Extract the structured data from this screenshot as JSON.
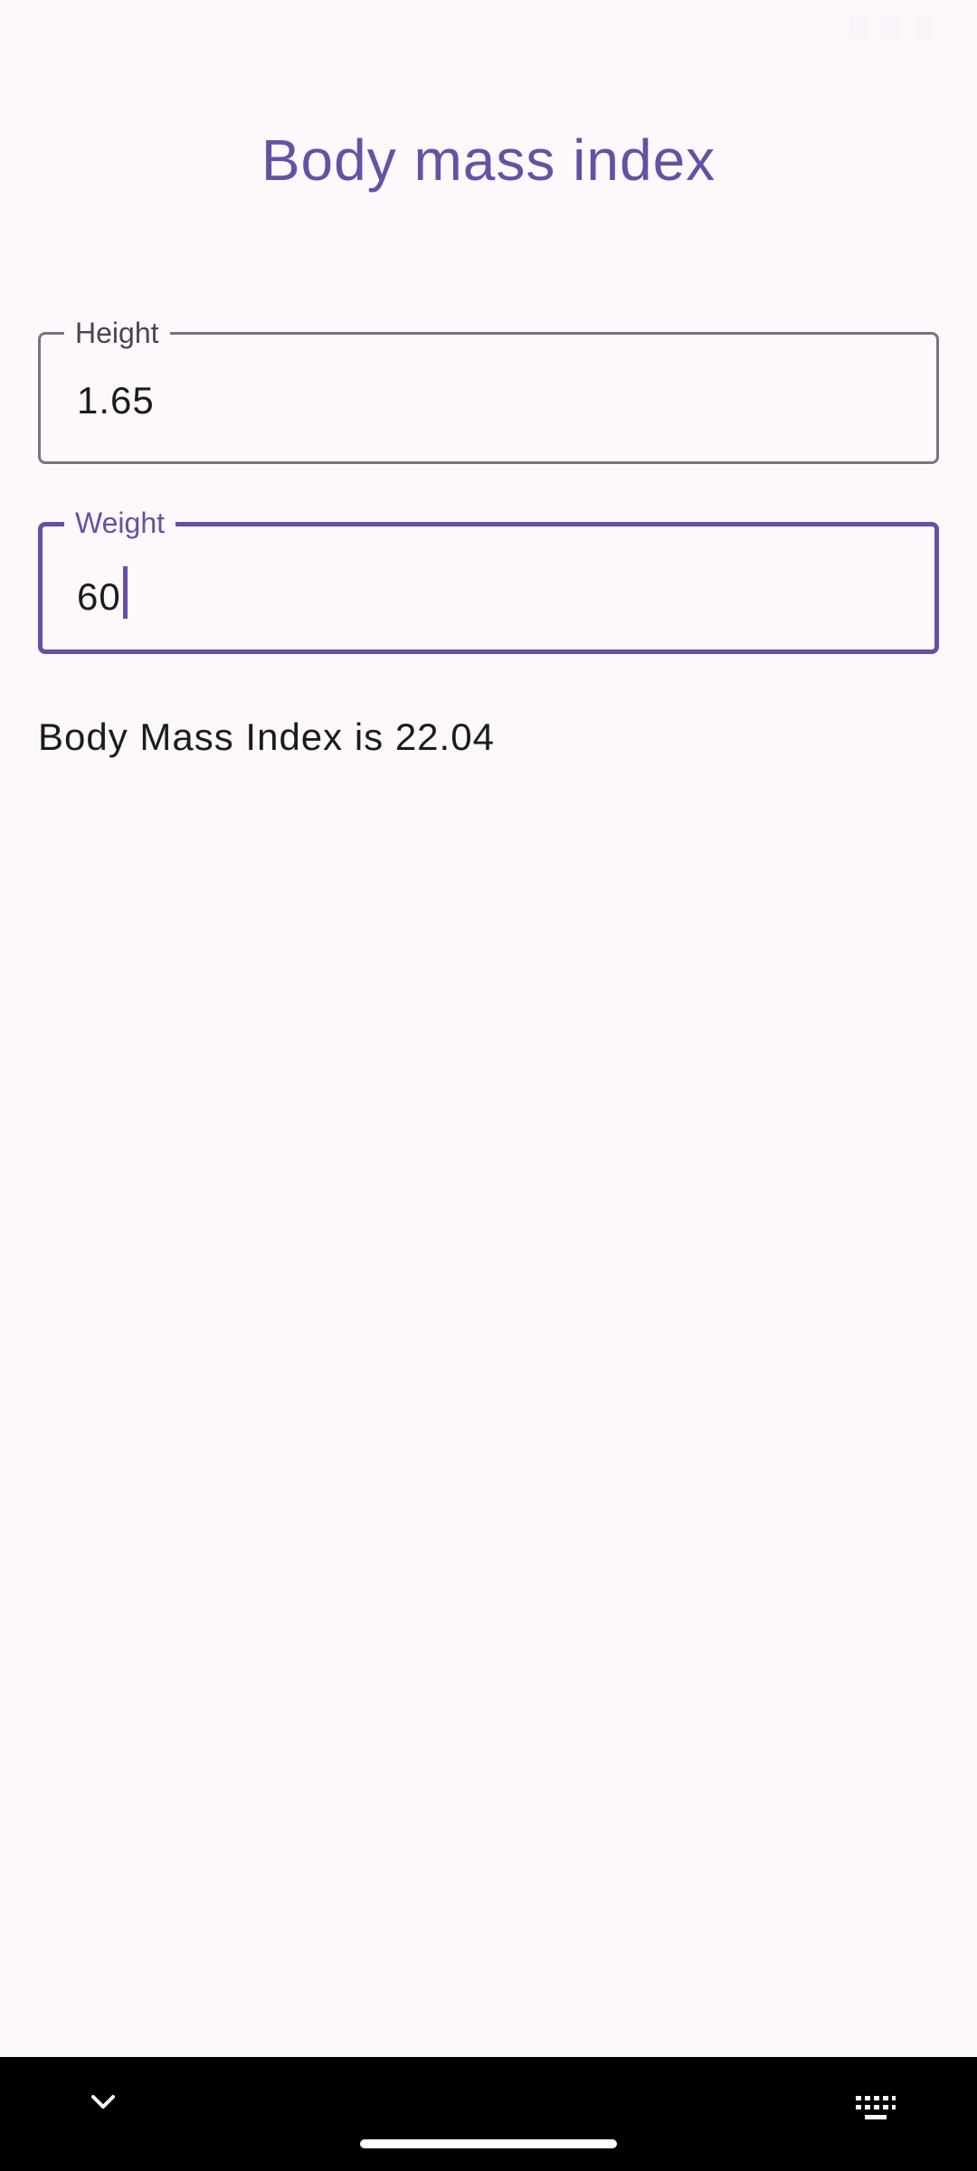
{
  "app": {
    "title": "Body mass index"
  },
  "form": {
    "height": {
      "label": "Height",
      "value": "1.65"
    },
    "weight": {
      "label": "Weight",
      "value": "60"
    }
  },
  "result": {
    "text": "Body Mass Index is 22.04"
  },
  "icons": {
    "nav_left": "chevron-down-icon",
    "nav_right": "keyboard-icon"
  },
  "colors": {
    "accent": "#6750a4",
    "background": "#fdf8fc",
    "outline": "#79747e",
    "text": "#1c1b1f",
    "nav_background": "#000000"
  }
}
